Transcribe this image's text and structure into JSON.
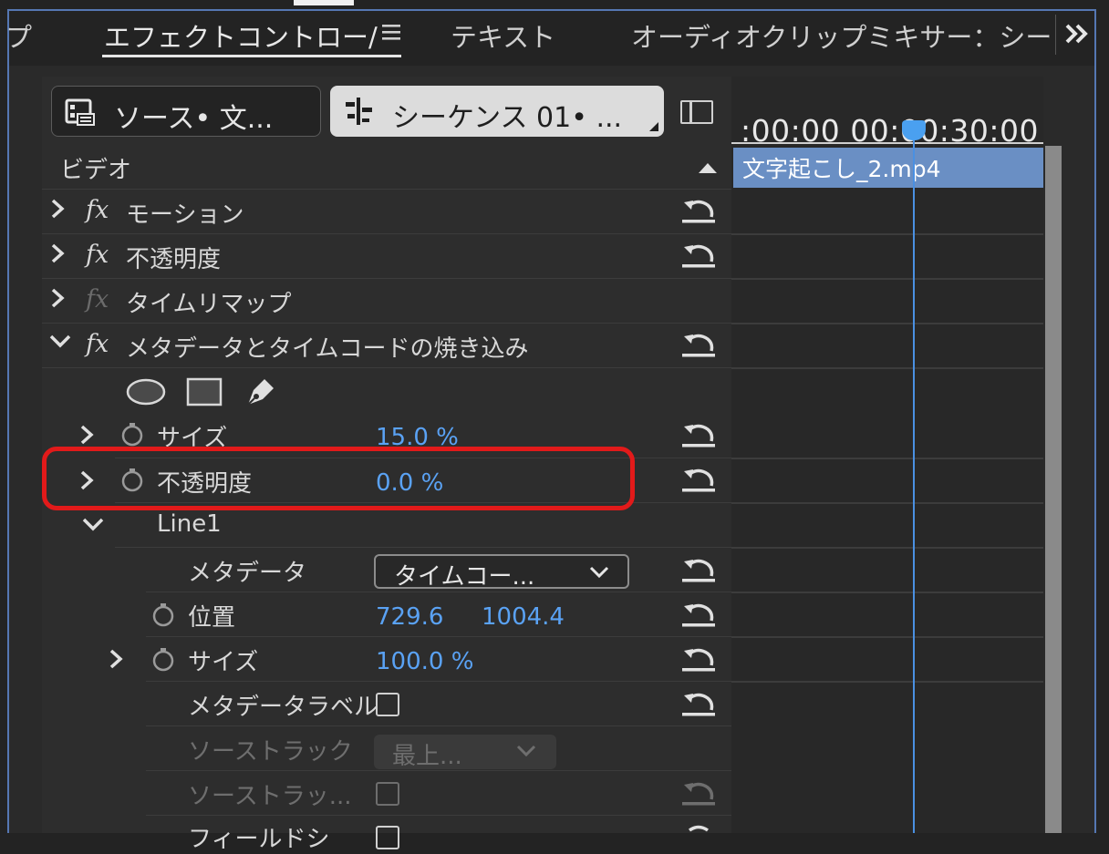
{
  "tabs": {
    "partial_left": "プ",
    "effect_controls": "エフェクトコントロー/",
    "menu_icon": "hamburger-menu-icon",
    "text": "テキスト",
    "audio_mixer": "オーディオクリップミキサー：シーク",
    "overflow_icon": "double-chevron-right-icon"
  },
  "source": {
    "label": "ソース• 文..."
  },
  "sequence": {
    "label": "シーケンス 01• ..."
  },
  "video_section": {
    "label": "ビデオ"
  },
  "effects": [
    {
      "name": "モーション",
      "expanded": false,
      "enabled": true
    },
    {
      "name": "不透明度",
      "expanded": false,
      "enabled": true
    },
    {
      "name": "タイムリマップ",
      "expanded": false,
      "enabled": false
    },
    {
      "name": "メタデータとタイムコードの焼き込み",
      "expanded": true,
      "enabled": true
    }
  ],
  "props": {
    "size": {
      "label": "サイズ",
      "value": "15.0 %"
    },
    "opacity": {
      "label": "不透明度",
      "value": "0.0 %"
    },
    "line1": {
      "label": "Line1"
    },
    "metadata": {
      "label": "メタデータ",
      "value": "タイムコー..."
    },
    "position": {
      "label": "位置",
      "x": "729.6",
      "y": "1004.4"
    },
    "line_size": {
      "label": "サイズ",
      "value": "100.0 %"
    },
    "metadata_label": {
      "label": "メタデータラベル"
    },
    "source_track": {
      "label": "ソーストラック",
      "value": "最上..."
    },
    "source_track2": {
      "label": "ソーストラッ..."
    },
    "field_partial": {
      "label": "フィールドシ"
    }
  },
  "timeline": {
    "ruler_text": ":00:00  00:00:30:00",
    "clip_name": "文字起こし_2.mp4"
  },
  "colors": {
    "accent_blue": "#5aa2f4",
    "clip_blue": "#6a8fc4",
    "highlight_red": "#e21a1a"
  }
}
